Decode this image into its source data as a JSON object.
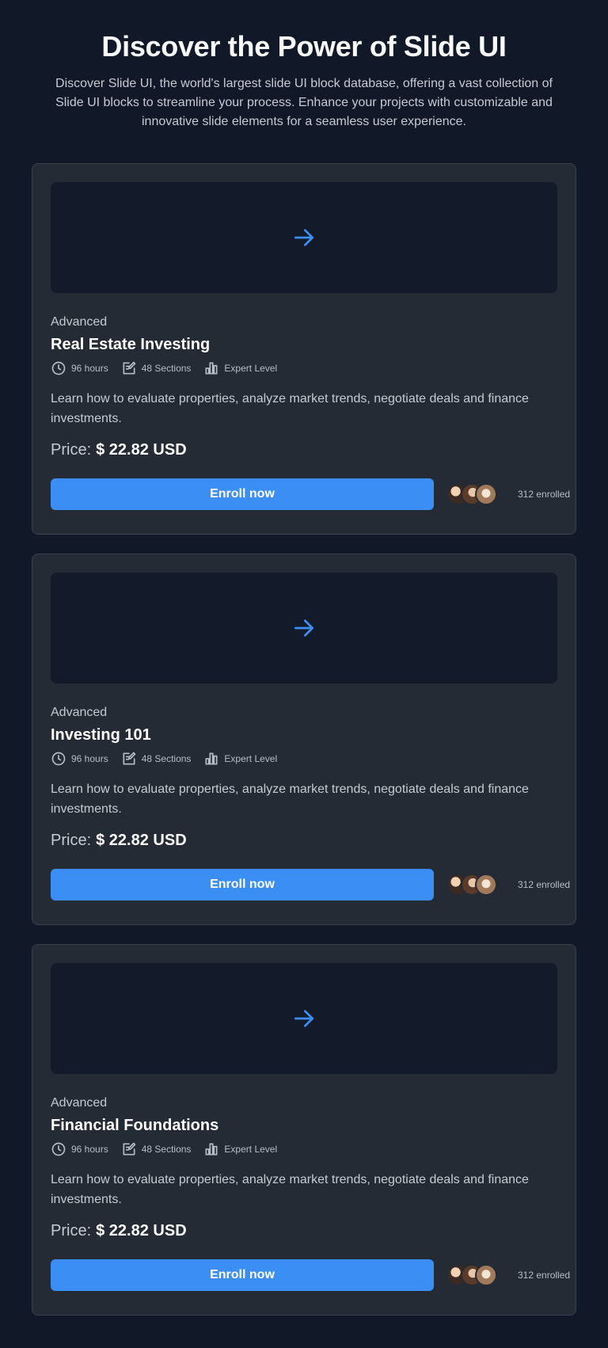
{
  "header": {
    "title": "Discover the Power of Slide UI",
    "subtitle": "Discover Slide UI, the world's largest slide UI block database, offering a vast collection of Slide UI blocks to streamline your process. Enhance your projects with customizable and innovative slide elements for a seamless user experience."
  },
  "colors": {
    "background": "#111827",
    "card": "#252b34",
    "accent": "#3b8ff4"
  },
  "icons": {
    "thumbnail": "arrow-right-icon",
    "duration": "clock-icon",
    "sections": "edit-document-icon",
    "level": "bar-chart-icon"
  },
  "cards": [
    {
      "level_label": "Advanced",
      "title": "Real Estate Investing",
      "hours": "96 hours",
      "sections": "48 Sections",
      "level": "Expert Level",
      "description": "Learn how to evaluate properties, analyze market trends, negotiate deals and finance investments.",
      "price_label": "Price:",
      "price_value": "$ 22.82 USD",
      "button": "Enroll now",
      "enrolled": "312 enrolled"
    },
    {
      "level_label": "Advanced",
      "title": "Investing 101",
      "hours": "96 hours",
      "sections": "48 Sections",
      "level": "Expert Level",
      "description": "Learn how to evaluate properties, analyze market trends, negotiate deals and finance investments.",
      "price_label": "Price:",
      "price_value": "$ 22.82 USD",
      "button": "Enroll now",
      "enrolled": "312 enrolled"
    },
    {
      "level_label": "Advanced",
      "title": "Financial Foundations",
      "hours": "96 hours",
      "sections": "48 Sections",
      "level": "Expert Level",
      "description": "Learn how to evaluate properties, analyze market trends, negotiate deals and finance investments.",
      "price_label": "Price:",
      "price_value": "$ 22.82 USD",
      "button": "Enroll now",
      "enrolled": "312 enrolled"
    }
  ]
}
